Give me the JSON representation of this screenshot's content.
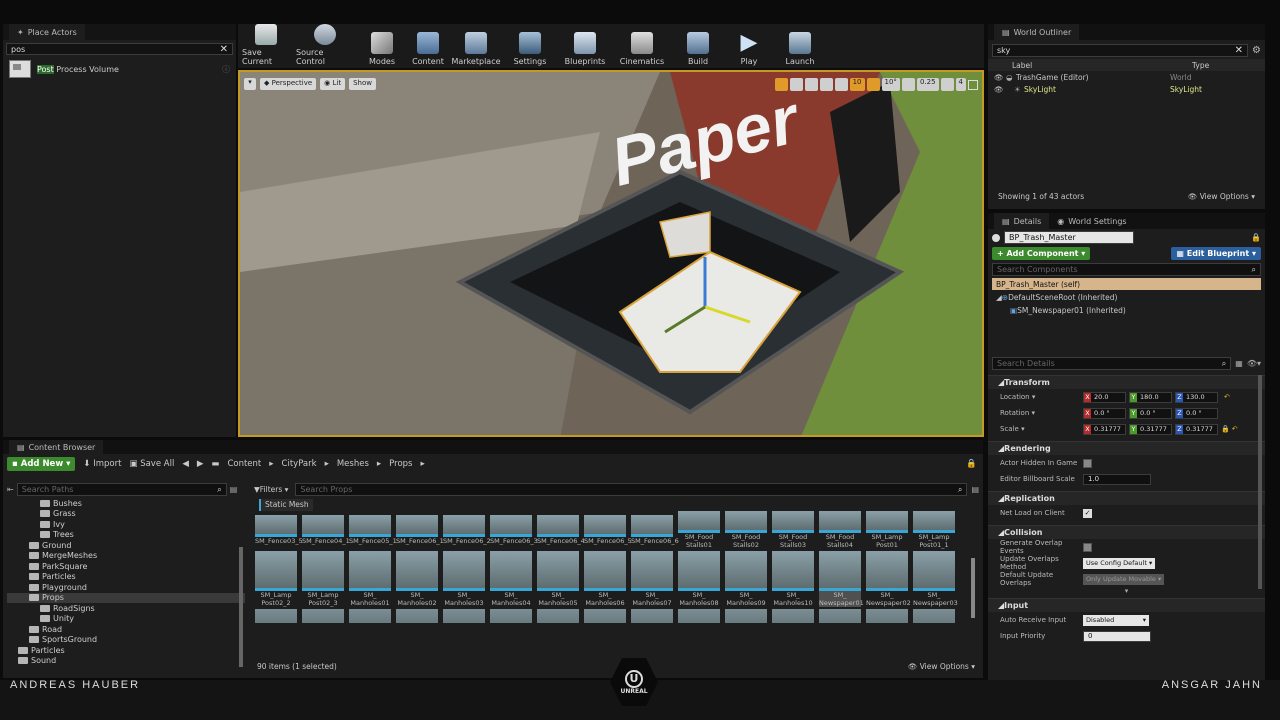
{
  "place_actors": {
    "tab": "Place Actors",
    "search_value": "pos",
    "result_prefix": "Post",
    "result_rest": " Process Volume"
  },
  "toolbar": {
    "buttons": [
      {
        "label": "Save Current",
        "icon": "save-icon"
      },
      {
        "label": "Source Control",
        "icon": "source-control-icon"
      },
      {
        "label": "Modes",
        "icon": "modes-icon"
      },
      {
        "label": "Content",
        "icon": "content-icon"
      },
      {
        "label": "Marketplace",
        "icon": "marketplace-icon"
      },
      {
        "label": "Settings",
        "icon": "settings-icon"
      },
      {
        "label": "Blueprints",
        "icon": "blueprints-icon"
      },
      {
        "label": "Cinematics",
        "icon": "cinematics-icon"
      },
      {
        "label": "Build",
        "icon": "build-icon"
      },
      {
        "label": "Play",
        "icon": "play-icon"
      },
      {
        "label": "Launch",
        "icon": "launch-icon"
      }
    ]
  },
  "viewport": {
    "perspective": "Perspective",
    "lit": "Lit",
    "show": "Show",
    "snap_grid": "10",
    "snap_rot": "10°",
    "snap_scale": "0.25",
    "cam_speed": "4",
    "scene_text": "Paper"
  },
  "outliner": {
    "tab": "World Outliner",
    "search_value": "sky",
    "col_label": "Label",
    "col_type": "Type",
    "rows": [
      {
        "label": "TrashGame (Editor)",
        "type": "World"
      },
      {
        "label": "SkyLight",
        "type": "SkyLight"
      }
    ],
    "status": "Showing 1 of 43 actors",
    "view_options": "View Options"
  },
  "details": {
    "tab_details": "Details",
    "tab_world_settings": "World Settings",
    "actor_name": "BP_Trash_Master",
    "add_component": "+ Add Component",
    "edit_blueprint": "Edit Blueprint",
    "search_components_placeholder": "Search Components",
    "components": [
      {
        "label": "BP_Trash_Master (self)"
      },
      {
        "label": "DefaultSceneRoot (Inherited)"
      },
      {
        "label": "SM_Newspaper01 (Inherited)"
      }
    ],
    "search_details_placeholder": "Search Details",
    "sections": {
      "transform": "Transform",
      "rendering": "Rendering",
      "replication": "Replication",
      "collision": "Collision",
      "input": "Input"
    },
    "location": {
      "label": "Location",
      "x": "20.0",
      "y": "180.0",
      "z": "130.0"
    },
    "rotation": {
      "label": "Rotation",
      "x": "0.0 °",
      "y": "0.0 °",
      "z": "0.0 °"
    },
    "scale": {
      "label": "Scale",
      "x": "0.31777",
      "y": "0.31777",
      "z": "0.31777"
    },
    "actor_hidden": "Actor Hidden In Game",
    "billboard_scale": {
      "label": "Editor Billboard Scale",
      "value": "1.0"
    },
    "net_load": "Net Load on Client",
    "gen_overlap": "Generate Overlap Events",
    "update_overlaps": {
      "label": "Update Overlaps Method",
      "value": "Use Config Default"
    },
    "default_update_overlaps": {
      "label": "Default Update Overlaps",
      "value": "Only Update Movable"
    },
    "auto_receive": {
      "label": "Auto Receive Input",
      "value": "Disabled"
    },
    "input_priority": {
      "label": "Input Priority",
      "value": "0"
    }
  },
  "content_browser": {
    "tab": "Content Browser",
    "add_new": "Add New",
    "import": "Import",
    "save_all": "Save All",
    "breadcrumb": [
      "Content",
      "CityPark",
      "Meshes",
      "Props"
    ],
    "search_paths_placeholder": "Search Paths",
    "filters": "Filters",
    "search_props_placeholder": "Search Props",
    "filter_chip": "Static Mesh",
    "tree": [
      {
        "label": "Bushes",
        "indent": 3
      },
      {
        "label": "Grass",
        "indent": 3
      },
      {
        "label": "Ivy",
        "indent": 3
      },
      {
        "label": "Trees",
        "indent": 3
      },
      {
        "label": "Ground",
        "indent": 2
      },
      {
        "label": "MergeMeshes",
        "indent": 2
      },
      {
        "label": "ParkSquare",
        "indent": 2
      },
      {
        "label": "Particles",
        "indent": 2
      },
      {
        "label": "Playground",
        "indent": 2
      },
      {
        "label": "Props",
        "indent": 2
      },
      {
        "label": "RoadSigns",
        "indent": 3
      },
      {
        "label": "Unity",
        "indent": 3
      },
      {
        "label": "Road",
        "indent": 2
      },
      {
        "label": "SportsGround",
        "indent": 2
      },
      {
        "label": "Particles",
        "indent": 1
      },
      {
        "label": "Sound",
        "indent": 1
      }
    ],
    "row1": [
      "SM_Fence03_5",
      "SM_Fence04_1",
      "SM_Fence05_1",
      "SM_Fence06_1",
      "SM_Fence06_2",
      "SM_Fence06_3",
      "SM_Fence06_4",
      "SM_Fence06_5",
      "SM_Fence06_6",
      "SM_Food Stalls01",
      "SM_Food Stalls02",
      "SM_Food Stalls03",
      "SM_Food Stalls04",
      "SM_Lamp Post01",
      "SM_Lamp Post01_1"
    ],
    "row2": [
      "SM_Lamp Post02_2",
      "SM_Lamp Post02_3",
      "SM_ Manholes01",
      "SM_ Manholes02",
      "SM_ Manholes03",
      "SM_ Manholes04",
      "SM_ Manholes05",
      "SM_ Manholes06",
      "SM_ Manholes07",
      "SM_ Manholes08",
      "SM_ Manholes09",
      "SM_ Manholes10",
      "SM_ Newspaper01",
      "SM_ Newspaper02",
      "SM_ Newspaper03"
    ],
    "status": "90 items (1 selected)",
    "view_options": "View Options"
  },
  "footer": {
    "left": "ANDREAS HAUBER",
    "right": "ANSGAR JAHN",
    "logo": "UNREAL"
  }
}
